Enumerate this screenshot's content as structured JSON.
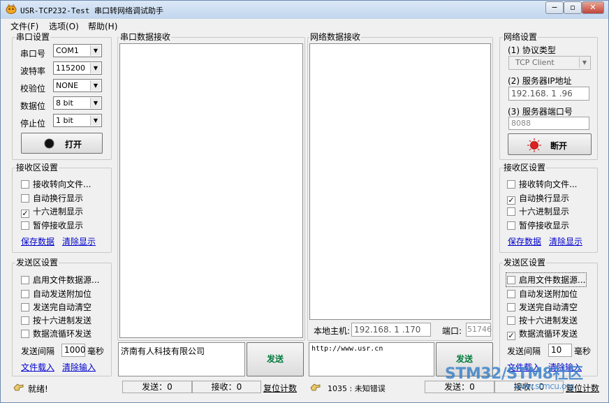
{
  "window": {
    "title": "USR-TCP232-Test 串口转网络调试助手",
    "minimize": "−",
    "maximize": "▫",
    "close": "✕"
  },
  "menu": [
    "文件(F)",
    "选项(O)",
    "帮助(H)"
  ],
  "serial_settings": {
    "legend": "串口设置",
    "port_label": "串口号",
    "port_value": "COM1",
    "baud_label": "波特率",
    "baud_value": "115200",
    "parity_label": "校验位",
    "parity_value": "NONE",
    "databits_label": "数据位",
    "databits_value": "8 bit",
    "stopbits_label": "停止位",
    "stopbits_value": "1 bit",
    "open_button": "打开"
  },
  "serial_receive_settings": {
    "legend": "接收区设置",
    "options": [
      {
        "label": "接收转向文件...",
        "checked": false
      },
      {
        "label": "自动换行显示",
        "checked": false
      },
      {
        "label": "十六进制显示",
        "checked": true
      },
      {
        "label": "暂停接收显示",
        "checked": false
      }
    ],
    "save_link": "保存数据",
    "clear_link": "清除显示"
  },
  "serial_send_settings": {
    "legend": "发送区设置",
    "options": [
      {
        "label": "启用文件数据源...",
        "checked": false
      },
      {
        "label": "自动发送附加位",
        "checked": false
      },
      {
        "label": "发送完自动清空",
        "checked": false
      },
      {
        "label": "按十六进制发送",
        "checked": false
      },
      {
        "label": "数据流循环发送",
        "checked": false
      }
    ],
    "interval_label": "发送间隔",
    "interval_value": "1000",
    "interval_unit": "毫秒",
    "load_link": "文件载入",
    "clear_link": "清除输入"
  },
  "serial_receive_area": {
    "legend": "串口数据接收"
  },
  "network_receive_area": {
    "legend": "网络数据接收"
  },
  "serial_send": {
    "text": "济南有人科技有限公司",
    "button": "发送"
  },
  "network_send": {
    "text": "http://www.usr.cn",
    "button": "发送"
  },
  "local_host": {
    "label": "本地主机:",
    "ip": "192.168. 1 .170",
    "port_label": "端口:",
    "port": "51746"
  },
  "network_settings": {
    "legend": "网络设置",
    "protocol_label": "(1) 协议类型",
    "protocol_value": "TCP Client",
    "ip_label": "(2) 服务器IP地址",
    "ip_value": "192.168. 1 .96",
    "port_label": "(3) 服务器端口号",
    "port_value": "8088",
    "disconnect_button": "断开"
  },
  "network_receive_settings": {
    "legend": "接收区设置",
    "options": [
      {
        "label": "接收转向文件...",
        "checked": false
      },
      {
        "label": "自动换行显示",
        "checked": true
      },
      {
        "label": "十六进制显示",
        "checked": false
      },
      {
        "label": "暂停接收显示",
        "checked": false
      }
    ],
    "save_link": "保存数据",
    "clear_link": "清除显示"
  },
  "network_send_settings": {
    "legend": "发送区设置",
    "options": [
      {
        "label": "启用文件数据源...",
        "checked": false
      },
      {
        "label": "自动发送附加位",
        "checked": false
      },
      {
        "label": "发送完自动清空",
        "checked": false
      },
      {
        "label": "按十六进制发送",
        "checked": false
      },
      {
        "label": "数据流循环发送",
        "checked": true
      }
    ],
    "interval_label": "发送间隔",
    "interval_value": "10",
    "interval_unit": "毫秒",
    "load_link": "文件载入",
    "clear_link": "清除输入"
  },
  "status_left": {
    "status": "就绪!",
    "sent": "发送：0",
    "received": "接收：0",
    "reset": "复位计数"
  },
  "status_right": {
    "status": "1035 : 未知错误",
    "sent": "发送：0",
    "received": "接收：0",
    "reset": "复位计数"
  },
  "watermark": {
    "text": "STM32/STM8社区",
    "url": "www.stmcu.org"
  },
  "colors": {
    "link": "#0000cc",
    "led_on": "#e02020",
    "led_off": "#111111",
    "accent_send": "#007a3d"
  }
}
